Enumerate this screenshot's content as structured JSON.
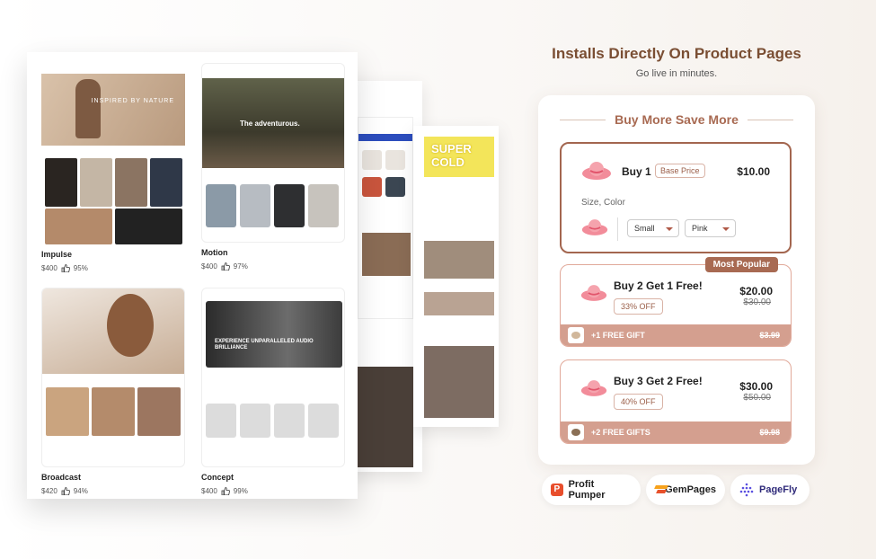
{
  "themes": [
    {
      "name": "Impulse",
      "price": "$400",
      "rating": "95%",
      "hero_text": "INSPIRED BY NATURE"
    },
    {
      "name": "Motion",
      "price": "$400",
      "rating": "97%",
      "hero_text": "The adventurous."
    },
    {
      "name": "Broadcast",
      "price": "$420",
      "rating": "94%",
      "hero_text": ""
    },
    {
      "name": "Concept",
      "price": "$400",
      "rating": "99%",
      "hero_text": "EXPERIENCE UNPARALLELED AUDIO BRILLIANCE"
    }
  ],
  "back_sheet": {
    "banner_text": "SUPER COLD"
  },
  "header": {
    "title": "Installs Directly On Product Pages",
    "subtitle": "Go live in minutes."
  },
  "widget": {
    "title": "Buy More Save More",
    "offers": [
      {
        "label": "Buy 1",
        "badge": "Base Price",
        "price": "$10.00",
        "variant_label": "Size, Color",
        "size": "Small",
        "color": "Pink"
      },
      {
        "label": "Buy 2 Get 1 Free!",
        "ribbon": "Most Popular",
        "discount": "33% OFF",
        "price": "$20.00",
        "old_price": "$30.00",
        "gift": "+1 FREE GIFT",
        "gift_price": "$3.99"
      },
      {
        "label": "Buy 3 Get 2 Free!",
        "discount": "40% OFF",
        "price": "$30.00",
        "old_price": "$50.00",
        "gift": "+2 FREE GIFTS",
        "gift_price": "$9.98"
      }
    ]
  },
  "partners": [
    {
      "name": "Profit Pumper",
      "icon": "profit-pumper-logo"
    },
    {
      "name": "GemPages",
      "icon": "gempages-logo"
    },
    {
      "name": "PageFly",
      "icon": "pagefly-logo"
    }
  ],
  "colors": {
    "brand": "#a86a52",
    "heading": "#7a4e33",
    "gift_bar": "#d49f8f",
    "profit_pumper": "#e84e2c",
    "pagefly": "#5a4fe0"
  }
}
